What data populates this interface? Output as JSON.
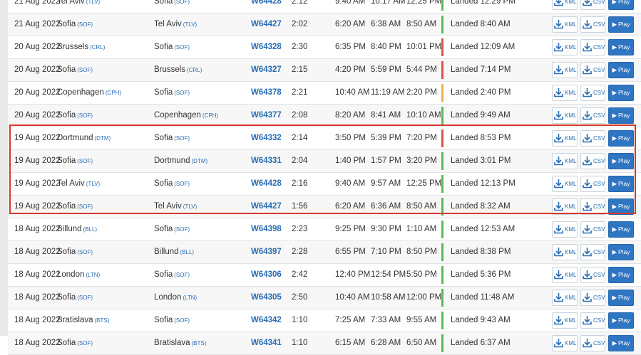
{
  "colors": {
    "green": "#5cb85c",
    "red": "#d9534f",
    "yellow": "#f0ad4e",
    "highlight": "#d9372b",
    "link": "#2a6db3",
    "play": "#2e75c2"
  },
  "buttons": {
    "kml_label": "KML",
    "csv_label": "CSV",
    "play_label": "Play",
    "play_glyph": "▶"
  },
  "rows": [
    {
      "date": "21 Aug 2022",
      "from": "Tel Aviv",
      "from_code": "(TLV)",
      "to": "Sofia",
      "to_code": "(SOF)",
      "flight": "W64428",
      "duration": "2:12",
      "dep": "9:40 AM",
      "off": "10:17 AM",
      "arr": "12:25 PM",
      "status": "Landed 12:29 PM",
      "status_color": "green"
    },
    {
      "date": "21 Aug 2022",
      "from": "Sofia",
      "from_code": "(SOF)",
      "to": "Tel Aviv",
      "to_code": "(TLV)",
      "flight": "W64427",
      "duration": "2:02",
      "dep": "6:20 AM",
      "off": "6:38 AM",
      "arr": "8:50 AM",
      "status": "Landed 8:40 AM",
      "status_color": "green"
    },
    {
      "date": "20 Aug 2022",
      "from": "Brussels",
      "from_code": "(CRL)",
      "to": "Sofia",
      "to_code": "(SOF)",
      "flight": "W64328",
      "duration": "2:30",
      "dep": "6:35 PM",
      "off": "8:40 PM",
      "arr": "10:01 PM",
      "status": "Landed 12:09 AM",
      "status_color": "red"
    },
    {
      "date": "20 Aug 2022",
      "from": "Sofia",
      "from_code": "(SOF)",
      "to": "Brussels",
      "to_code": "(CRL)",
      "flight": "W64327",
      "duration": "2:15",
      "dep": "4:20 PM",
      "off": "5:59 PM",
      "arr": "5:44 PM",
      "status": "Landed 7:14 PM",
      "status_color": "red"
    },
    {
      "date": "20 Aug 2022",
      "from": "Copenhagen",
      "from_code": "(CPH)",
      "to": "Sofia",
      "to_code": "(SOF)",
      "flight": "W64378",
      "duration": "2:21",
      "dep": "10:40 AM",
      "off": "11:19 AM",
      "arr": "2:20 PM",
      "status": "Landed 2:40 PM",
      "status_color": "yellow"
    },
    {
      "date": "20 Aug 2022",
      "from": "Sofia",
      "from_code": "(SOF)",
      "to": "Copenhagen",
      "to_code": "(CPH)",
      "flight": "W64377",
      "duration": "2:08",
      "dep": "8:20 AM",
      "off": "8:41 AM",
      "arr": "10:10 AM",
      "status": "Landed 9:49 AM",
      "status_color": "green"
    },
    {
      "date": "19 Aug 2022",
      "from": "Dortmund",
      "from_code": "(DTM)",
      "to": "Sofia",
      "to_code": "(SOF)",
      "flight": "W64332",
      "duration": "2:14",
      "dep": "3:50 PM",
      "off": "5:39 PM",
      "arr": "7:20 PM",
      "status": "Landed 8:53 PM",
      "status_color": "red"
    },
    {
      "date": "19 Aug 2022",
      "from": "Sofia",
      "from_code": "(SOF)",
      "to": "Dortmund",
      "to_code": "(DTM)",
      "flight": "W64331",
      "duration": "2:04",
      "dep": "1:40 PM",
      "off": "1:57 PM",
      "arr": "3:20 PM",
      "status": "Landed 3:01 PM",
      "status_color": "green"
    },
    {
      "date": "19 Aug 2022",
      "from": "Tel Aviv",
      "from_code": "(TLV)",
      "to": "Sofia",
      "to_code": "(SOF)",
      "flight": "W64428",
      "duration": "2:16",
      "dep": "9:40 AM",
      "off": "9:57 AM",
      "arr": "12:25 PM",
      "status": "Landed 12:13 PM",
      "status_color": "green"
    },
    {
      "date": "19 Aug 2022",
      "from": "Sofia",
      "from_code": "(SOF)",
      "to": "Tel Aviv",
      "to_code": "(TLV)",
      "flight": "W64427",
      "duration": "1:56",
      "dep": "6:20 AM",
      "off": "6:36 AM",
      "arr": "8:50 AM",
      "status": "Landed 8:32 AM",
      "status_color": "green"
    },
    {
      "date": "18 Aug 2022",
      "from": "Billund",
      "from_code": "(BLL)",
      "to": "Sofia",
      "to_code": "(SOF)",
      "flight": "W64398",
      "duration": "2:23",
      "dep": "9:25 PM",
      "off": "9:30 PM",
      "arr": "1:10 AM",
      "status": "Landed 12:53 AM",
      "status_color": "green"
    },
    {
      "date": "18 Aug 2022",
      "from": "Sofia",
      "from_code": "(SOF)",
      "to": "Billund",
      "to_code": "(BLL)",
      "flight": "W64397",
      "duration": "2:28",
      "dep": "6:55 PM",
      "off": "7:10 PM",
      "arr": "8:50 PM",
      "status": "Landed 8:38 PM",
      "status_color": "green"
    },
    {
      "date": "18 Aug 2022",
      "from": "London",
      "from_code": "(LTN)",
      "to": "Sofia",
      "to_code": "(SOF)",
      "flight": "W64306",
      "duration": "2:42",
      "dep": "12:40 PM",
      "off": "12:54 PM",
      "arr": "5:50 PM",
      "status": "Landed 5:36 PM",
      "status_color": "green"
    },
    {
      "date": "18 Aug 2022",
      "from": "Sofia",
      "from_code": "(SOF)",
      "to": "London",
      "to_code": "(LTN)",
      "flight": "W64305",
      "duration": "2:50",
      "dep": "10:40 AM",
      "off": "10:58 AM",
      "arr": "12:00 PM",
      "status": "Landed 11:48 AM",
      "status_color": "green"
    },
    {
      "date": "18 Aug 2022",
      "from": "Bratislava",
      "from_code": "(BTS)",
      "to": "Sofia",
      "to_code": "(SOF)",
      "flight": "W64342",
      "duration": "1:10",
      "dep": "7:25 AM",
      "off": "7:33 AM",
      "arr": "9:55 AM",
      "status": "Landed 9:43 AM",
      "status_color": "green"
    },
    {
      "date": "18 Aug 2022",
      "from": "Sofia",
      "from_code": "(SOF)",
      "to": "Bratislava",
      "to_code": "(BTS)",
      "flight": "W64341",
      "duration": "1:10",
      "dep": "6:15 AM",
      "off": "6:28 AM",
      "arr": "6:50 AM",
      "status": "Landed 6:37 AM",
      "status_color": "green"
    }
  ]
}
